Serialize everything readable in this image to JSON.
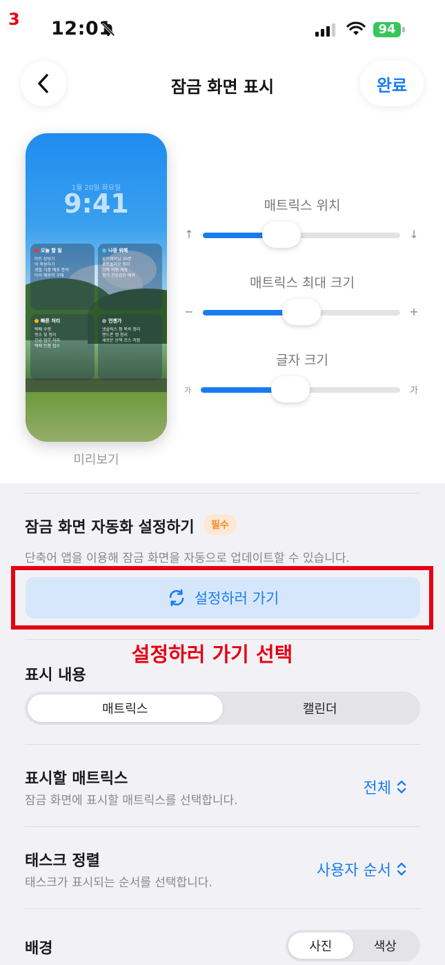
{
  "annotation_step": "3",
  "status": {
    "time": "12:01",
    "battery": "94"
  },
  "header": {
    "title": "잠금 화면 표시",
    "done_label": "완료"
  },
  "preview": {
    "date": "1월 20일 화요일",
    "clock": "9:41",
    "label": "미리보기",
    "widgets": [
      {
        "title": "오늘 할 일",
        "color": "#e53935",
        "items": [
          "마트 장보기",
          "약 복용하기",
          "생필 식품 배포 준비",
          "아이 예방약 구매"
        ]
      },
      {
        "title": "나중 위해",
        "color": "#4fc3f7",
        "items": [
          "울트레이닝 30분",
          "포트폴리오 정리",
          "가족 여행 계획",
          "정기 건강검진 예약"
        ]
      },
      {
        "title": "빠른 처리",
        "color": "#ffb300",
        "items": [
          "택배 수령",
          "청소 및 정리",
          "긴급 업무 처리",
          "택배 반품 접수"
        ]
      },
      {
        "title": "언젠가",
        "color": "#9e9e9e",
        "items": [
          "넷플릭스 찜 목록 정리",
          "핸드폰 앱 정리",
          "새로운 산책 코스 저장"
        ]
      }
    ]
  },
  "sliders": [
    {
      "label": "매트릭스 위치",
      "left_icon": "↑",
      "right_icon": "↓",
      "value": 0.4
    },
    {
      "label": "매트릭스 최대 크기",
      "left_icon": "−",
      "right_icon": "+",
      "value": 0.5
    },
    {
      "label": "글자 크기",
      "left_icon": "가",
      "right_icon": "가",
      "value": 0.45
    }
  ],
  "automation": {
    "title": "잠금 화면 자동화 설정하기",
    "badge": "필수",
    "description": "단축어 앱을 이용해 잠금 화면을 자동으로 업데이트할 수 있습니다.",
    "button_label": "설정하러 가기",
    "annotation": "설정하러 가기 선택"
  },
  "display_content": {
    "title": "표시 내용",
    "options": [
      "매트릭스",
      "캘린더"
    ],
    "selected": "매트릭스"
  },
  "matrix_display": {
    "title": "표시할 매트릭스",
    "description": "잠금 화면에 표시할 매트릭스를 선택합니다.",
    "value": "전체"
  },
  "task_sort": {
    "title": "태스크 정렬",
    "description": "태스크가 표시되는 순서를 선택합니다.",
    "value": "사용자 순서"
  },
  "background": {
    "title": "배경",
    "options": [
      "사진",
      "색상"
    ],
    "selected": "사진"
  }
}
